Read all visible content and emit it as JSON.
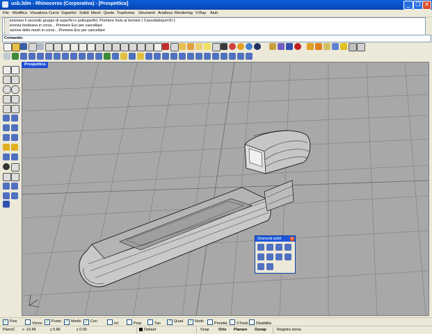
{
  "window": {
    "title": "usb.3dm - Rhinoceros (Corporativa) - [Prospettica]"
  },
  "menu": [
    "File",
    "Modifica",
    "Visualizza",
    "Curve",
    "Superfici",
    "Solidi",
    "Mesh",
    "Quote",
    "Trasforma",
    "Strumenti",
    "Analizza",
    "Rendering",
    "V-Ray",
    "Aiuti"
  ],
  "history": [
    "Selezionare il secondo gruppo di superfici o polisuperfici. Premere Invio al termine ( CancellaInput=Sì ):",
    "Differenza booleana in corso... Premere Esc per cancellare",
    "Creazione delle mesh in corso... Premere Esc per cancellare"
  ],
  "command_label": "Comando:",
  "viewport": {
    "tab": "Prospettica"
  },
  "panel": {
    "title": "Strumenti solidi"
  },
  "osnap": [
    {
      "label": "Fine",
      "checked": true
    },
    {
      "label": "Vicino",
      "checked": false
    },
    {
      "label": "Punto",
      "checked": true
    },
    {
      "label": "Medio",
      "checked": true
    },
    {
      "label": "Cen",
      "checked": true
    },
    {
      "label": "Int",
      "checked": false
    },
    {
      "label": "Perp",
      "checked": false
    },
    {
      "label": "Tan",
      "checked": false
    },
    {
      "label": "Quad",
      "checked": true
    },
    {
      "label": "Nodo",
      "checked": true
    },
    {
      "label": "Proietta",
      "checked": false
    },
    {
      "label": "STrack",
      "checked": false
    },
    {
      "label": "Disabilita",
      "checked": false
    }
  ],
  "status": {
    "plane": "PianoC",
    "x": "x -19.48",
    "y": "y 5.86",
    "z": "z 0.00",
    "layer": "Default",
    "snap": "Snap",
    "orto": "Orto",
    "planare": "Planare",
    "osnap": "Osnap",
    "registra": "Registra storia"
  },
  "colors": {
    "title_bar": "#0846b4",
    "viewport_bg": "#a8a8a8",
    "viewport_tab": "#1e50d6",
    "model_fill": "#c9c9c9"
  }
}
